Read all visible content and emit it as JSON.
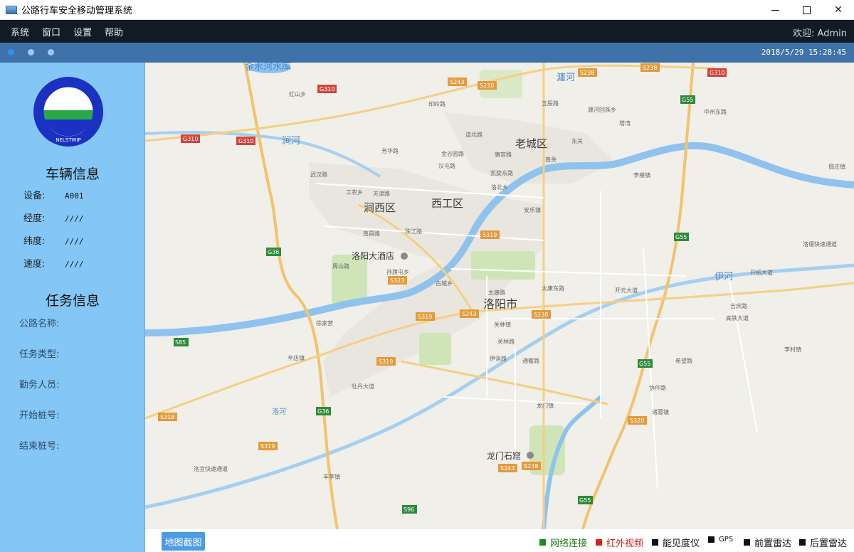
{
  "window": {
    "title": "公路行车安全移动管理系统"
  },
  "menu": {
    "items": [
      "系统",
      "窗口",
      "设置",
      "帮助"
    ],
    "welcome": "欢迎: Admin"
  },
  "status": {
    "datetime": "2018/5/29 15:28:45"
  },
  "sidebar": {
    "vehicle_title": "车辆信息",
    "vehicle_fields": [
      {
        "label": "设备:",
        "value": "A001"
      },
      {
        "label": "经度:",
        "value": "////"
      },
      {
        "label": "纬度:",
        "value": "////"
      },
      {
        "label": "速度:",
        "value": "////"
      }
    ],
    "task_title": "任务信息",
    "task_fields": [
      {
        "label": "公路名称:"
      },
      {
        "label": "任务类型:"
      },
      {
        "label": "勤务人员:"
      },
      {
        "label": "开始桩号:"
      },
      {
        "label": "结束桩号:"
      }
    ]
  },
  "map": {
    "districts": [
      "老城区",
      "西工区",
      "涧西区",
      "洛阳市"
    ],
    "landmarks": [
      "洛阳大酒店",
      "龙门石窟"
    ],
    "water": [
      "金水河水库",
      "涧河",
      "瀍河",
      "洛河",
      "伊河"
    ],
    "road_signs": [
      "G310",
      "S243",
      "S238",
      "G55",
      "G36",
      "S319",
      "S323",
      "S85",
      "S318",
      "S96",
      "S320"
    ],
    "streets": [
      "红山乡",
      "印岭路",
      "五股路",
      "瀍河回族乡",
      "塔湾",
      "中州东路",
      "道北路",
      "唐宫路",
      "东关",
      "芳华路",
      "金谷园路",
      "汉屯路",
      "凯旋东路",
      "南关",
      "李楼镇",
      "武汉路",
      "工农乡",
      "天津路",
      "洛北乡",
      "安乐镇",
      "佃庄镇",
      "南昌路",
      "珠江路",
      "周山路",
      "孙旗屯乡",
      "古城乡",
      "太康路",
      "太康东路",
      "开元大道",
      "洛偃快速通道",
      "开拓大道",
      "吉庆路",
      "高铁大道",
      "徐家营",
      "牡丹大道",
      "关林镇",
      "伊洛路",
      "通衢路",
      "辛店镇",
      "关林路",
      "希望路",
      "协作路",
      "诸葛镇",
      "龙门镇",
      "李村镇",
      "丰李镇",
      "洛宜快速通道"
    ]
  },
  "bottom": {
    "capture_button": "地图截图",
    "indicators": [
      {
        "label": "网络连接",
        "color": "#1f8a1f"
      },
      {
        "label": "红外视频",
        "color": "#e01e1e"
      },
      {
        "label": "能见度仪",
        "color": "#111111"
      },
      {
        "label": "GPS",
        "color": "#111111"
      },
      {
        "label": "前置雷达",
        "color": "#111111"
      },
      {
        "label": "后置雷达",
        "color": "#111111"
      }
    ]
  },
  "logo": {
    "text": "NELSTWIP"
  }
}
